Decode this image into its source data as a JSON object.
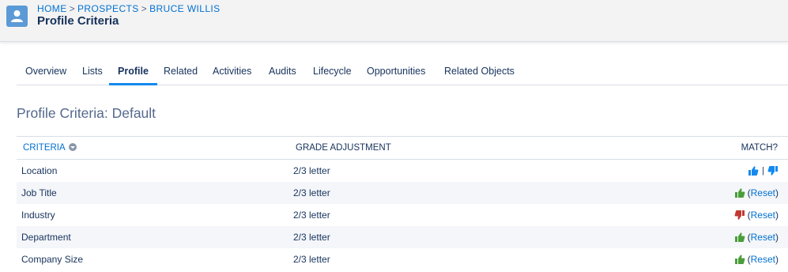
{
  "header": {
    "breadcrumb": [
      "HOME",
      "PROSPECTS",
      "BRUCE WILLIS"
    ],
    "breadcrumb_sep": ">",
    "title": "Profile Criteria"
  },
  "tabs": [
    "Overview",
    "Lists",
    "Profile",
    "Related",
    "Activities",
    "Audits",
    "Lifecycle",
    "Opportunities",
    "Related Objects"
  ],
  "active_tab": "Profile",
  "section_title": "Profile Criteria: Default",
  "table": {
    "columns": {
      "criteria": "CRITERIA",
      "grade": "GRADE ADJUSTMENT",
      "match": "MATCH?"
    },
    "reset_label": "Reset",
    "open_paren": "(",
    "close_paren": ")",
    "divider": "|",
    "rows": [
      {
        "criteria": "Location",
        "grade": "2/3 letter",
        "match": "unset"
      },
      {
        "criteria": "Job Title",
        "grade": "2/3 letter",
        "match": "up"
      },
      {
        "criteria": "Industry",
        "grade": "2/3 letter",
        "match": "down"
      },
      {
        "criteria": "Department",
        "grade": "2/3 letter",
        "match": "up"
      },
      {
        "criteria": "Company Size",
        "grade": "2/3 letter",
        "match": "up"
      }
    ]
  },
  "colors": {
    "link": "#0070d2",
    "thumb_neutral": "#1589ee",
    "thumb_up": "#4a9e3a",
    "thumb_down": "#c23934"
  },
  "icons": {
    "avatar": "person-icon",
    "sort": "sort-down-icon",
    "thumbs_up": "thumbs-up-icon",
    "thumbs_down": "thumbs-down-icon"
  }
}
